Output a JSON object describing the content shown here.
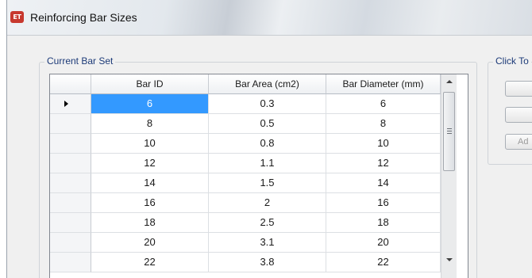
{
  "window": {
    "title": "Reinforcing Bar Sizes",
    "icon_label": "ET"
  },
  "group": {
    "label": "Current Bar Set"
  },
  "side_group": {
    "label": "Click To",
    "buttons": [
      "",
      "",
      "Ad"
    ]
  },
  "table": {
    "columns": [
      "Bar ID",
      "Bar Area  (cm2)",
      "Bar Diameter  (mm)"
    ],
    "selected_row": 0,
    "rows": [
      [
        "6",
        "0.3",
        "6"
      ],
      [
        "8",
        "0.5",
        "8"
      ],
      [
        "10",
        "0.8",
        "10"
      ],
      [
        "12",
        "1.1",
        "12"
      ],
      [
        "14",
        "1.5",
        "14"
      ],
      [
        "16",
        "2",
        "16"
      ],
      [
        "18",
        "2.5",
        "18"
      ],
      [
        "20",
        "3.1",
        "20"
      ],
      [
        "22",
        "3.8",
        "22"
      ]
    ]
  },
  "icons": {
    "row_pointer": "current-row-pointer-icon",
    "scroll_up": "chevron-up-icon",
    "scroll_down": "chevron-down-icon"
  },
  "colors": {
    "selection": "#3399ff",
    "group_label": "#1c3a78",
    "app_icon": "#c7382e"
  }
}
